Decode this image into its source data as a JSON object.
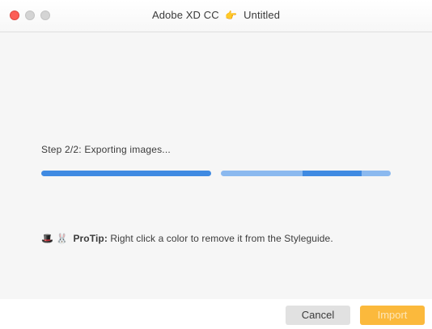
{
  "window": {
    "app_name": "Adobe XD CC",
    "title_separator_icon": "pointing-hand-emoji",
    "title_separator_glyph": "👉",
    "document_name": "Untitled"
  },
  "progress": {
    "step_text": "Step 2/2: Exporting images...",
    "bars": [
      {
        "name": "step-1",
        "fill_fraction": 1.0
      },
      {
        "name": "step-2",
        "fill_fraction": 0.35,
        "indeterminate": true
      }
    ],
    "colors": {
      "filled": "#3f8ae2",
      "track": "#8bb9ef"
    }
  },
  "protip": {
    "emoji_1": "🎩",
    "emoji_2": "🐰",
    "emoji_1_name": "top-hat-emoji",
    "emoji_2_name": "rabbit-emoji",
    "label": "ProTip:",
    "text": " Right click a color to remove it from the Styleguide."
  },
  "buttons": {
    "cancel_label": "Cancel",
    "import_label": "Import",
    "import_color": "#fbb93c"
  }
}
